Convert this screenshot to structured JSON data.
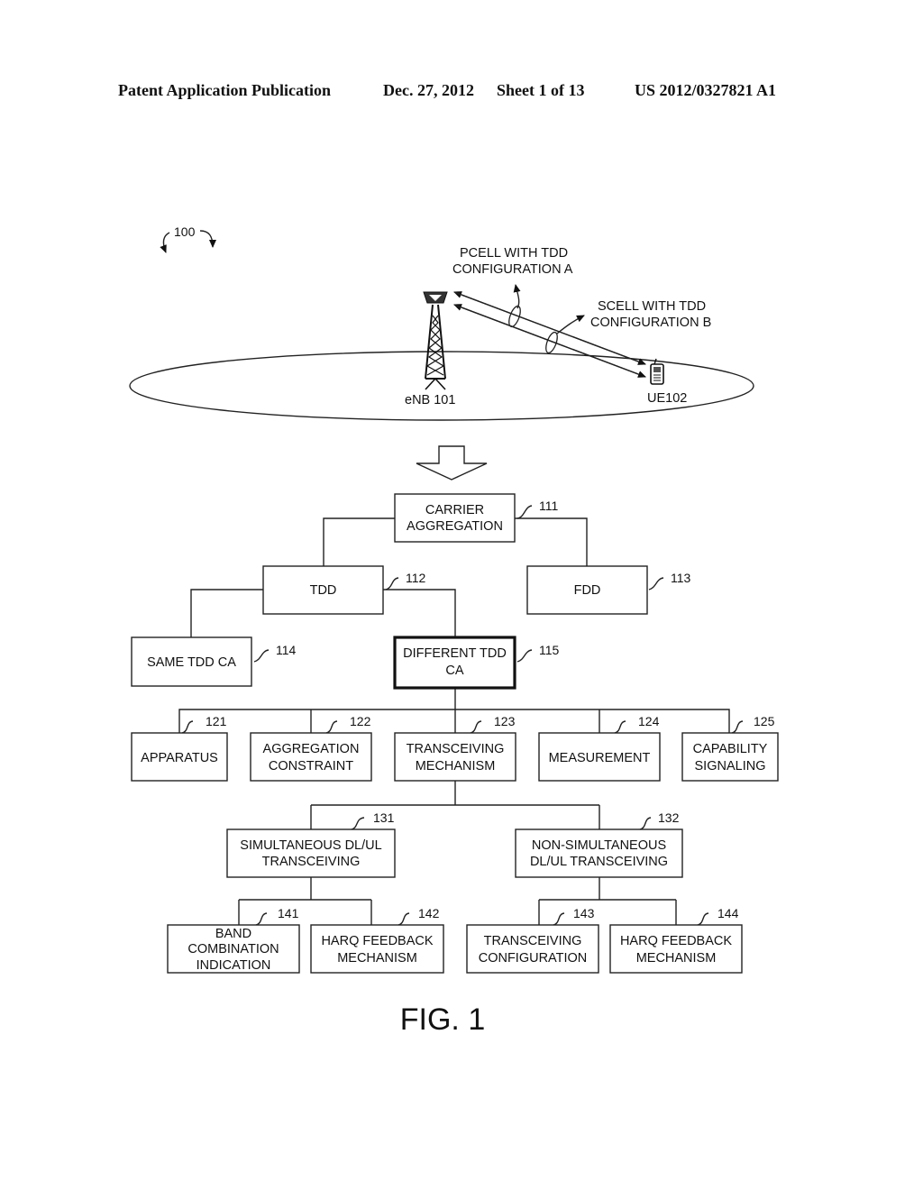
{
  "header": {
    "publication": "Patent Application Publication",
    "date": "Dec. 27, 2012",
    "sheet": "Sheet 1 of 13",
    "number": "US 2012/0327821 A1"
  },
  "scene": {
    "ref_100": "100",
    "pcell_line1": "PCELL WITH TDD",
    "pcell_line2": "CONFIGURATION A",
    "scell_line1": "SCELL WITH TDD",
    "scell_line2": "CONFIGURATION B",
    "enb_label": "eNB 101",
    "ue_label": "UE102"
  },
  "tree": {
    "n111": {
      "line1": "CARRIER",
      "line2": "AGGREGATION",
      "ref": "111"
    },
    "n112": {
      "line1": "TDD",
      "ref": "112"
    },
    "n113": {
      "line1": "FDD",
      "ref": "113"
    },
    "n114": {
      "line1": "SAME TDD CA",
      "ref": "114"
    },
    "n115": {
      "line1": "DIFFERENT TDD",
      "line2": "CA",
      "ref": "115"
    },
    "n121": {
      "line1": "APPARATUS",
      "ref": "121"
    },
    "n122": {
      "line1": "AGGREGATION",
      "line2": "CONSTRAINT",
      "ref": "122"
    },
    "n123": {
      "line1": "TRANSCEIVING",
      "line2": "MECHANISM",
      "ref": "123"
    },
    "n124": {
      "line1": "MEASUREMENT",
      "ref": "124"
    },
    "n125": {
      "line1": "CAPABILITY",
      "line2": "SIGNALING",
      "ref": "125"
    },
    "n131": {
      "line1": "SIMULTANEOUS DL/UL",
      "line2": "TRANSCEIVING",
      "ref": "131"
    },
    "n132": {
      "line1": "NON-SIMULTANEOUS",
      "line2": "DL/UL TRANSCEIVING",
      "ref": "132"
    },
    "n141": {
      "line1": "BAND",
      "line2": "COMBINATION",
      "line3": "INDICATION",
      "ref": "141"
    },
    "n142": {
      "line1": "HARQ FEEDBACK",
      "line2": "MECHANISM",
      "ref": "142"
    },
    "n143": {
      "line1": "TRANSCEIVING",
      "line2": "CONFIGURATION",
      "ref": "143"
    },
    "n144": {
      "line1": "HARQ FEEDBACK",
      "line2": "MECHANISM",
      "ref": "144"
    }
  },
  "figure_label": "FIG. 1"
}
